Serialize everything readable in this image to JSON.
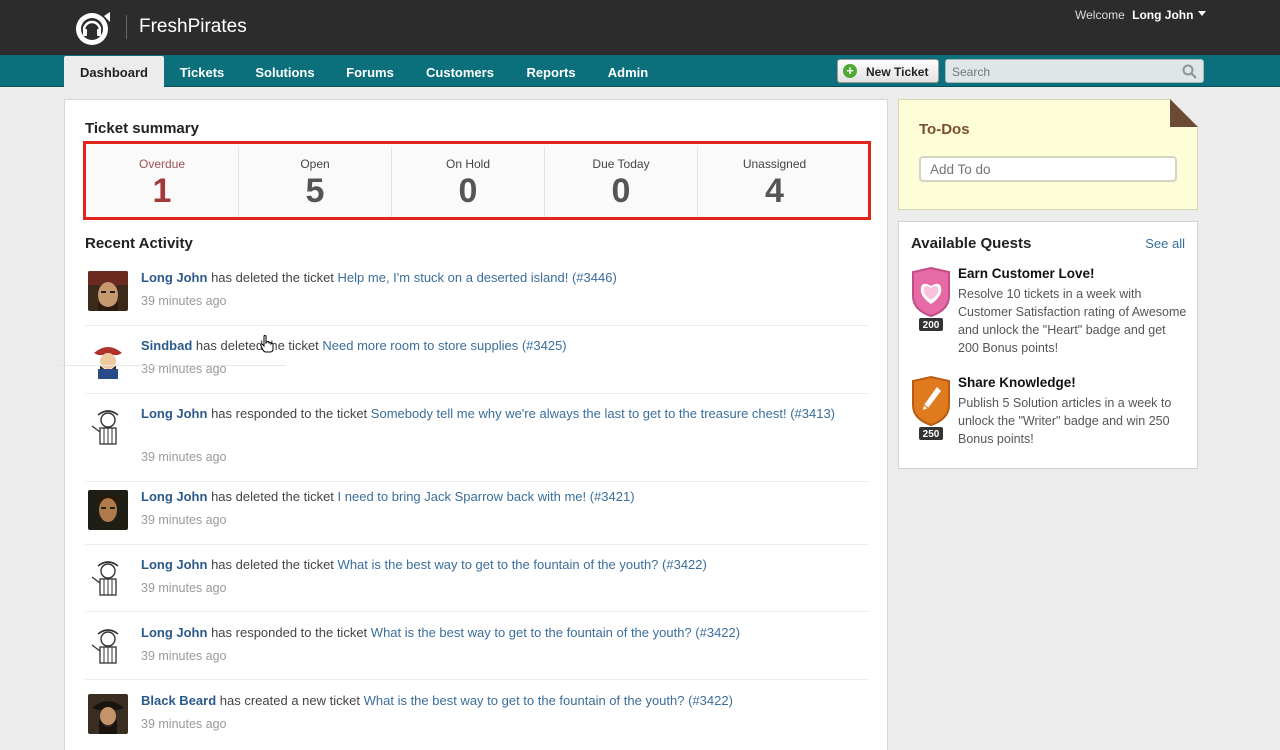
{
  "header": {
    "brand": "FreshPirates",
    "welcome_prefix": "Welcome",
    "user_name": "Long John",
    "logo_icon": "headset-icon"
  },
  "nav": {
    "tabs": [
      {
        "label": "Dashboard",
        "active": true
      },
      {
        "label": "Tickets"
      },
      {
        "label": "Solutions"
      },
      {
        "label": "Forums"
      },
      {
        "label": "Customers"
      },
      {
        "label": "Reports"
      },
      {
        "label": "Admin"
      }
    ],
    "new_ticket_label": "New Ticket",
    "search_placeholder": "Search"
  },
  "summary": {
    "title": "Ticket summary",
    "highlight_color": "#e1251b",
    "cells": [
      {
        "label": "Overdue",
        "value": "1"
      },
      {
        "label": "Open",
        "value": "5"
      },
      {
        "label": "On Hold",
        "value": "0"
      },
      {
        "label": "Due Today",
        "value": "0"
      },
      {
        "label": "Unassigned",
        "value": "4"
      }
    ]
  },
  "activity": {
    "title": "Recent Activity",
    "items": [
      {
        "user": "Long John",
        "action": "has deleted the ticket",
        "ticket": "Help me, I'm stuck on a deserted island! (#3446)",
        "time": "39 minutes ago",
        "avatar": "pirate-avatar-jack"
      },
      {
        "user": "Sindbad",
        "action": "has deleted the ticket",
        "ticket": "Need more room to store supplies (#3425)",
        "time": "39 minutes ago",
        "avatar": "pirate-avatar-cartoon"
      },
      {
        "user": "Long John",
        "action": "has responded to the ticket",
        "ticket": "Somebody tell me why we're always the last to get to the treasure chest! (#3413)",
        "time": "39 minutes ago",
        "avatar": "pirate-avatar-sketch"
      },
      {
        "user": "Long John",
        "action": "has deleted the ticket",
        "ticket": "I need to bring Jack Sparrow back with me! (#3421)",
        "time": "39 minutes ago",
        "avatar": "pirate-avatar-will"
      },
      {
        "user": "Long John",
        "action": "has deleted the ticket",
        "ticket": "What is the best way to get to the fountain of the youth? (#3422)",
        "time": "39 minutes ago",
        "avatar": "pirate-avatar-sketch"
      },
      {
        "user": "Long John",
        "action": "has responded to the ticket",
        "ticket": "What is the best way to get to the fountain of the youth? (#3422)",
        "time": "39 minutes ago",
        "avatar": "pirate-avatar-sketch"
      },
      {
        "user": "Black Beard",
        "action": "has created a new ticket",
        "ticket": "What is the best way to get to the fountain of the youth? (#3422)",
        "time": "39 minutes ago",
        "avatar": "pirate-avatar-blackbeard"
      }
    ]
  },
  "todos": {
    "title": "To-Dos",
    "placeholder": "Add To do"
  },
  "quests": {
    "title": "Available Quests",
    "see_all": "See all",
    "items": [
      {
        "title": "Earn Customer Love!",
        "desc": "Resolve 10 tickets in a week with Customer Satisfaction rating of Awesome and unlock the \"Heart\" badge and get 200 Bonus points!",
        "points": "200",
        "badge_icon": "heart-badge-icon",
        "badge_color": "#e56aa6"
      },
      {
        "title": "Share Knowledge!",
        "desc": "Publish 5 Solution articles in a week to unlock the \"Writer\" badge and win 250 Bonus points!",
        "points": "250",
        "badge_icon": "pen-badge-icon",
        "badge_color": "#e07a1f"
      }
    ]
  }
}
